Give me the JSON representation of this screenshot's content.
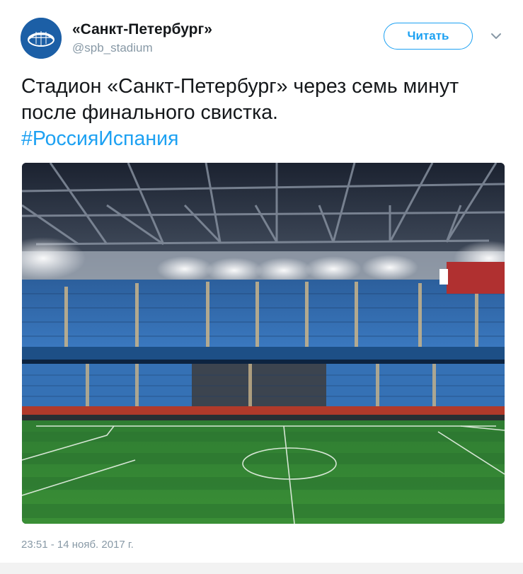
{
  "author": {
    "display_name": "«Санкт-Петербург»",
    "handle": "@spb_stadium",
    "avatar_icon": "stadium-logo-icon"
  },
  "actions": {
    "follow_label": "Читать",
    "menu_icon": "chevron-down-icon"
  },
  "tweet": {
    "text": "Стадион «Санкт-Петербург» через семь минут после финального свистка.",
    "hashtag": "#РоссияИспания",
    "media_description": "stadium-photo",
    "timestamp": "23:51 - 14 нояб. 2017 г."
  },
  "colors": {
    "accent": "#1da1f2",
    "secondary_text": "#8899a6",
    "primary_text": "#14171a"
  }
}
